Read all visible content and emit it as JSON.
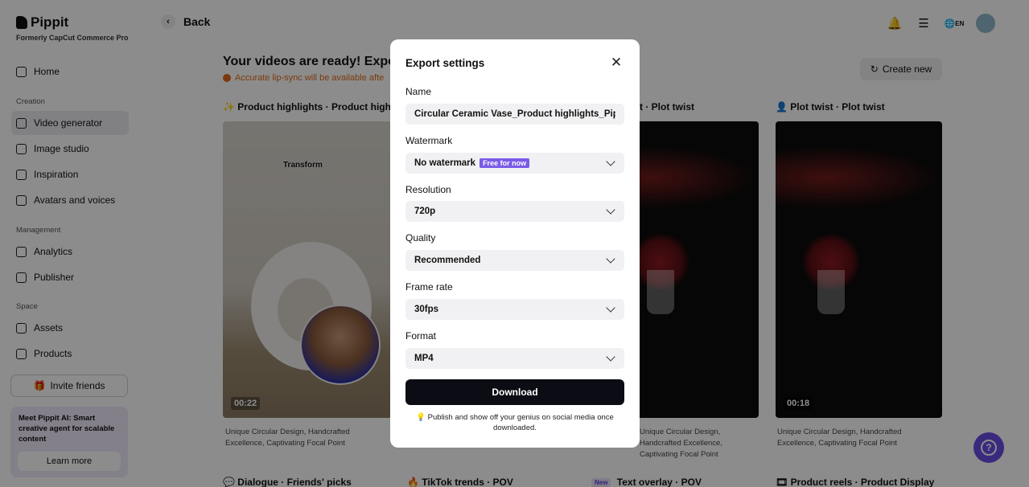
{
  "sidebar": {
    "brand": "Pippit",
    "brand_sub": "Formerly CapCut Commerce Pro",
    "home": "Home",
    "section_creation": "Creation",
    "creation_items": [
      "Video generator",
      "Image studio",
      "Inspiration",
      "Avatars and voices"
    ],
    "section_management": "Management",
    "management_items": [
      "Analytics",
      "Publisher"
    ],
    "section_space": "Space",
    "space_items": [
      "Assets",
      "Products"
    ],
    "invite": "Invite friends",
    "promo_text": "Meet Pippit AI: Smart creative agent for scalable content",
    "promo_button": "Learn more"
  },
  "header": {
    "back": "Back",
    "lang": "EN"
  },
  "main": {
    "title": "Your videos are ready! Expo",
    "warning": "Accurate lip-sync will be available afte",
    "create_new": "Create new",
    "cards": [
      {
        "title": "Product highlights · Product highli...",
        "duration": "00:22",
        "overlay": "Transform",
        "desc": "Unique Circular Design, Handcrafted Excellence, Captivating Focal Point"
      },
      {
        "title": "t · Plot twist",
        "desc": "Unique Circular Design, Handcrafted Excellence, Captivating Focal Point"
      },
      {
        "title": "Plot twist · Plot twist",
        "duration": "00:18",
        "desc": "Unique Circular Design, Handcrafted Excellence, Captivating Focal Point"
      }
    ],
    "row2": [
      "Dialogue · Friends' picks",
      "TikTok trends · POV",
      "Text overlay · POV",
      "Product reels · Product Display"
    ],
    "new_badge": "New"
  },
  "modal": {
    "title": "Export settings",
    "name_label": "Name",
    "name_value": "Circular Ceramic Vase_Product highlights_Pippit",
    "watermark_label": "Watermark",
    "watermark_value": "No watermark",
    "watermark_badge": "Free for now",
    "resolution_label": "Resolution",
    "resolution_value": "720p",
    "quality_label": "Quality",
    "quality_value": "Recommended",
    "framerate_label": "Frame rate",
    "framerate_value": "30fps",
    "format_label": "Format",
    "format_value": "MP4",
    "download": "Download",
    "footnote": "Publish and show off your genius on social media once downloaded."
  }
}
